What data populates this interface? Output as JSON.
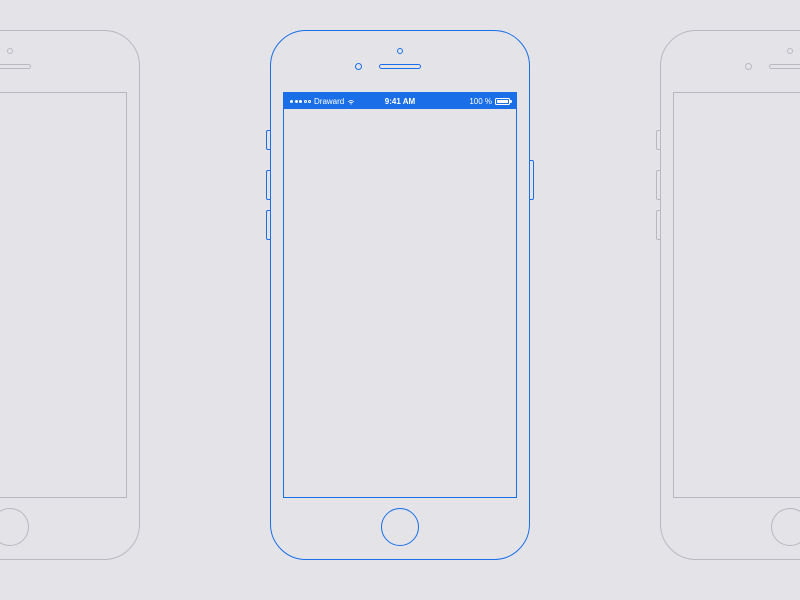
{
  "status_bar": {
    "carrier": "Draward",
    "time": "9:41 AM",
    "battery_pct": "100 %"
  },
  "colors": {
    "background": "#e4e4e8",
    "accent": "#1a6fe8",
    "outline_gray": "#b8b8c0"
  }
}
